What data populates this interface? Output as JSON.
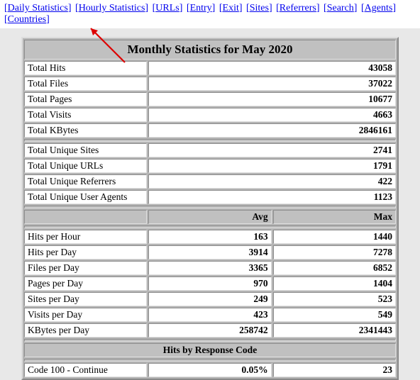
{
  "nav": {
    "daily": "Daily Statistics",
    "hourly": "Hourly Statistics",
    "urls": "URLs",
    "entry": "Entry",
    "exit": "Exit",
    "sites": "Sites",
    "referrers": "Referrers",
    "search": "Search",
    "agents": "Agents",
    "countries": "Countries"
  },
  "title": "Monthly Statistics for May 2020",
  "totals": {
    "hits": {
      "label": "Total Hits",
      "value": "43058"
    },
    "files": {
      "label": "Total Files",
      "value": "37022"
    },
    "pages": {
      "label": "Total Pages",
      "value": "10677"
    },
    "visits": {
      "label": "Total Visits",
      "value": "4663"
    },
    "kbytes": {
      "label": "Total KBytes",
      "value": "2846161"
    }
  },
  "unique": {
    "sites": {
      "label": "Total Unique Sites",
      "value": "2741"
    },
    "urls": {
      "label": "Total Unique URLs",
      "value": "1791"
    },
    "referrers": {
      "label": "Total Unique Referrers",
      "value": "422"
    },
    "agents": {
      "label": "Total Unique User Agents",
      "value": "1123"
    }
  },
  "colhead": {
    "avg": "Avg",
    "max": "Max"
  },
  "perday": {
    "hits_hour": {
      "label": "Hits per Hour",
      "avg": "163",
      "max": "1440"
    },
    "hits_day": {
      "label": "Hits per Day",
      "avg": "3914",
      "max": "7278"
    },
    "files_day": {
      "label": "Files per Day",
      "avg": "3365",
      "max": "6852"
    },
    "pages_day": {
      "label": "Pages per Day",
      "avg": "970",
      "max": "1404"
    },
    "sites_day": {
      "label": "Sites per Day",
      "avg": "249",
      "max": "523"
    },
    "visits_day": {
      "label": "Visits per Day",
      "avg": "423",
      "max": "549"
    },
    "kbytes_day": {
      "label": "KBytes per Day",
      "avg": "258742",
      "max": "2341443"
    }
  },
  "response": {
    "title": "Hits by Response Code",
    "r100": {
      "label": "Code 100 - Continue",
      "pct": "0.05%",
      "count": "23"
    }
  }
}
